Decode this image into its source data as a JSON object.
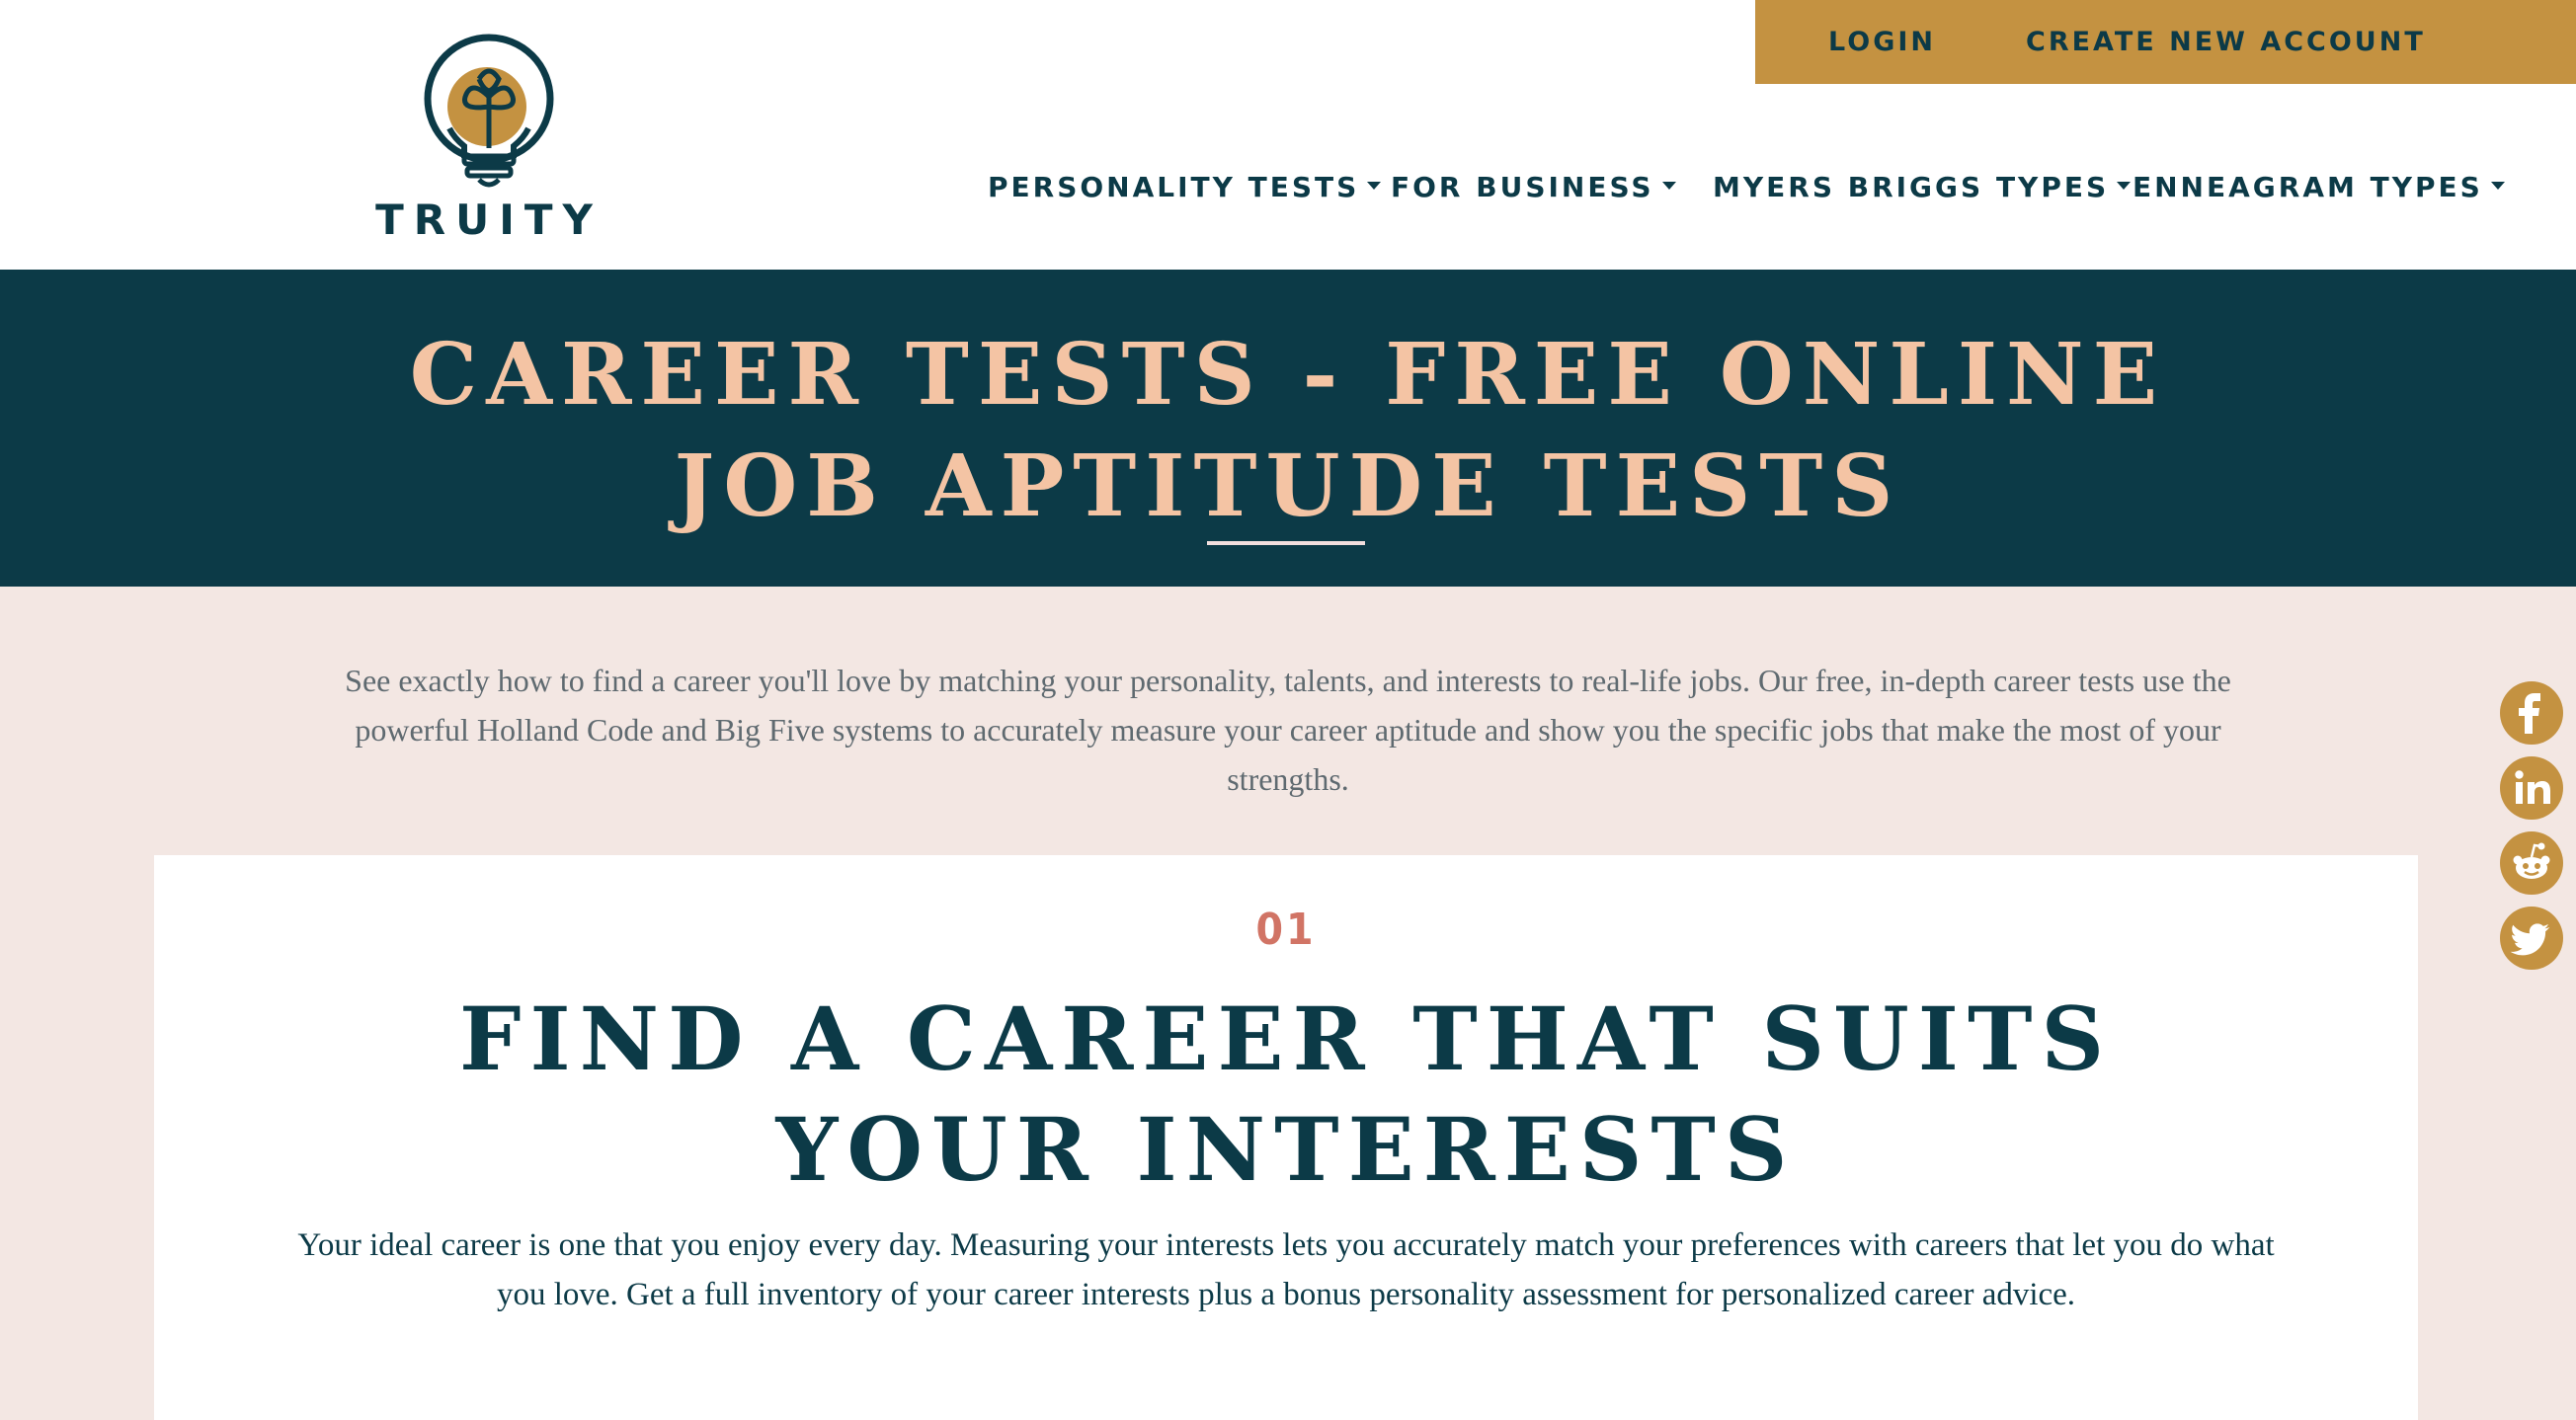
{
  "header": {
    "logo_text": "TRUITY",
    "account": {
      "login_label": "LOGIN",
      "create_label": "CREATE NEW ACCOUNT"
    },
    "nav": [
      {
        "label": "PERSONALITY TESTS"
      },
      {
        "label": "FOR BUSINESS"
      },
      {
        "label": "MYERS BRIGGS TYPES"
      },
      {
        "label": "ENNEAGRAM TYPES"
      }
    ]
  },
  "hero": {
    "title": "CAREER TESTS - FREE ONLINE JOB APTITUDE TESTS"
  },
  "intro": {
    "text": "See exactly how to find a career you'll love by matching your personality, talents, and interests to real-life jobs. Our free, in-depth career tests use the powerful Holland Code and Big Five systems to accurately measure your career aptitude and show you the specific jobs that make the most of your strengths."
  },
  "card": {
    "number": "01",
    "title": "FIND A CAREER THAT SUITS YOUR INTERESTS",
    "description": "Your ideal career is one that you enjoy every day. Measuring your interests lets you accurately match your preferences with careers that let you do what you love. Get a full inventory of your career interests plus a bonus personality assessment for personalized career advice."
  },
  "social": [
    {
      "icon": "facebook-icon"
    },
    {
      "icon": "linkedin-icon"
    },
    {
      "icon": "reddit-icon"
    },
    {
      "icon": "twitter-icon"
    }
  ],
  "colors": {
    "navy": "#0c3a47",
    "gold": "#c49241",
    "peach": "#f4c4a4",
    "background": "#f3e7e3",
    "accent_number": "#d17465"
  }
}
